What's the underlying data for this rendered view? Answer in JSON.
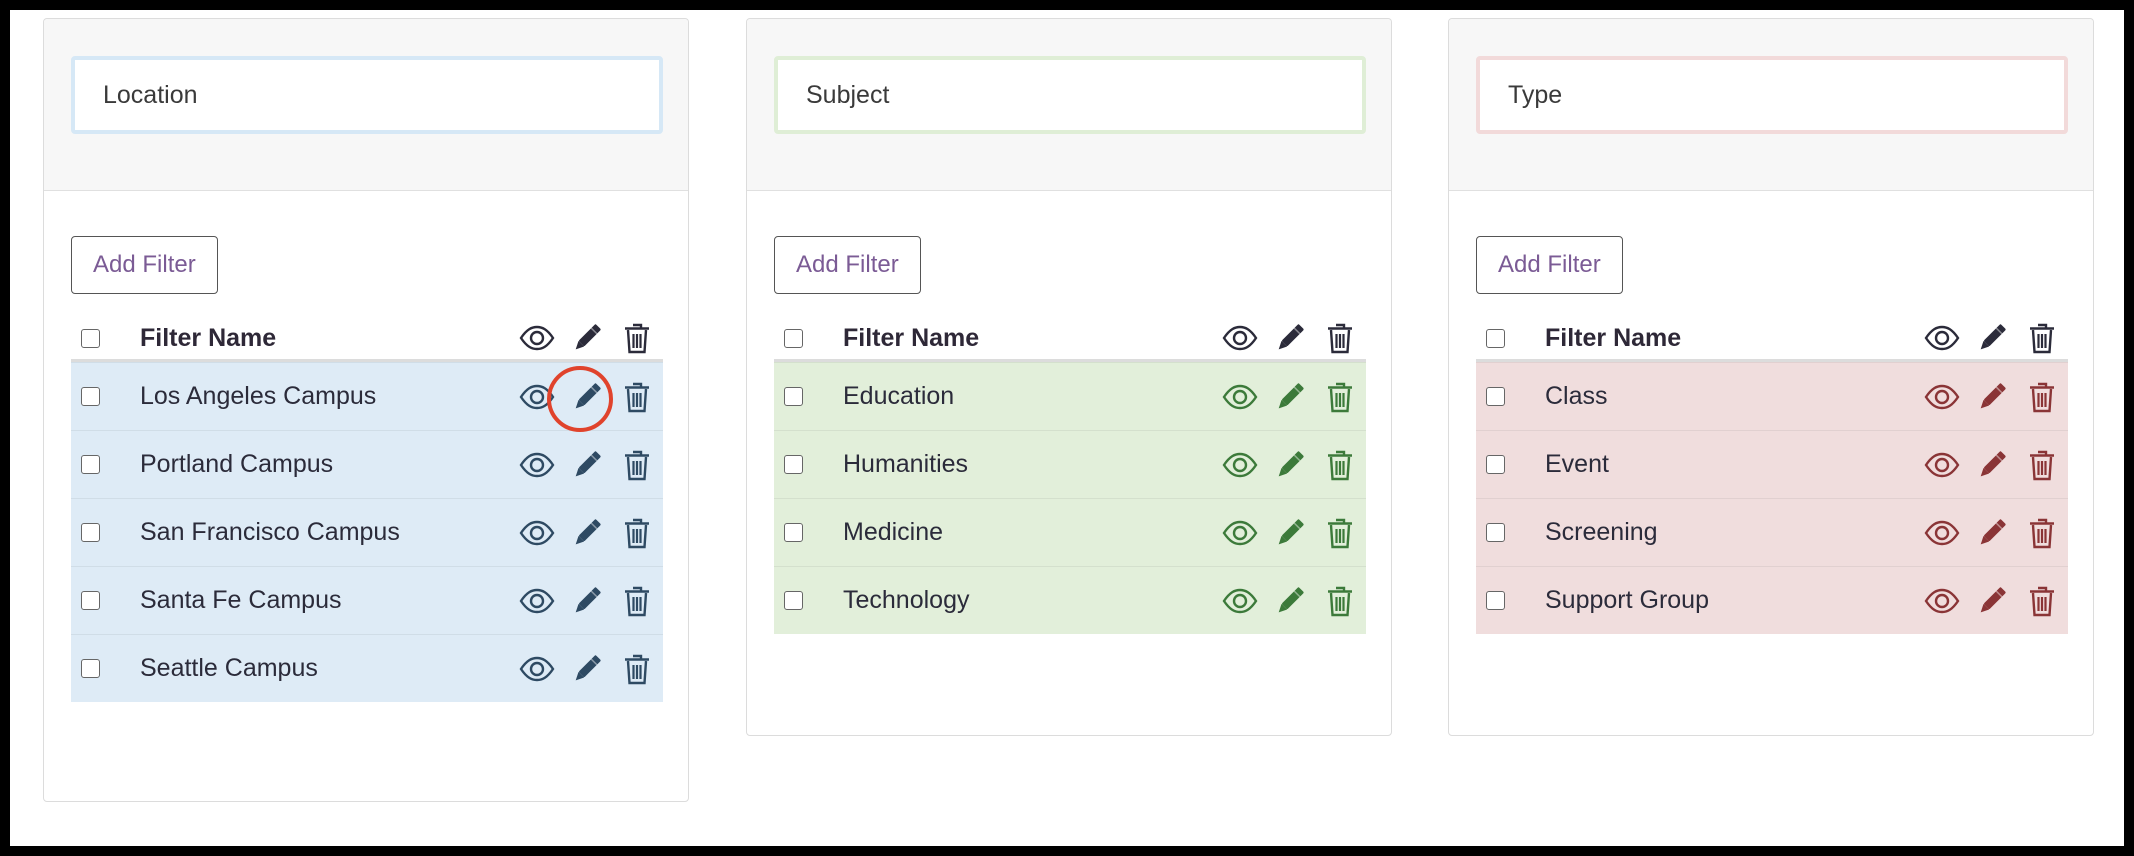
{
  "panels": [
    {
      "title": "Location",
      "add_button": "Add Filter",
      "header": "Filter Name",
      "colors": {
        "border": "#d6e8f6",
        "row_bg": "#deebf6",
        "icon": "#2e4a63",
        "header_icon": "#2b2b3a"
      },
      "rows": [
        "Los Angeles Campus",
        "Portland Campus",
        "San Francisco Campus",
        "Santa Fe Campus",
        "Seattle Campus"
      ]
    },
    {
      "title": "Subject",
      "add_button": "Add Filter",
      "header": "Filter Name",
      "colors": {
        "border": "#dfeed6",
        "row_bg": "#e2efda",
        "icon": "#3c7a3a",
        "header_icon": "#2b2b3a"
      },
      "rows": [
        "Education",
        "Humanities",
        "Medicine",
        "Technology"
      ]
    },
    {
      "title": "Type",
      "add_button": "Add Filter",
      "header": "Filter Name",
      "colors": {
        "border": "#f2dada",
        "row_bg": "#f0dddd",
        "icon": "#8a3436",
        "header_icon": "#2b2b3a"
      },
      "rows": [
        "Class",
        "Event",
        "Screening",
        "Support Group"
      ]
    }
  ],
  "highlight_color": "#e0432c"
}
